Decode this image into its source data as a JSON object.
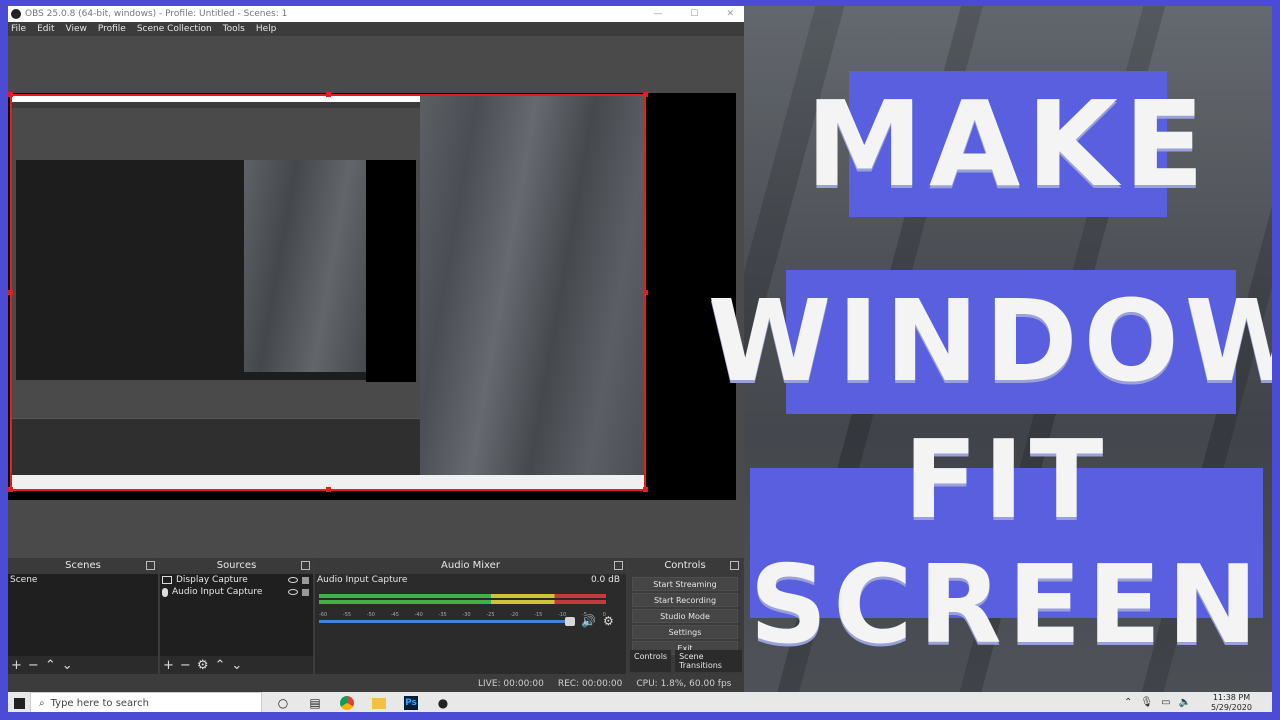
{
  "obs": {
    "title": "OBS 25.0.8 (64-bit, windows) - Profile: Untitled - Scenes: 1",
    "menu": [
      "File",
      "Edit",
      "View",
      "Profile",
      "Scene Collection",
      "Tools",
      "Help"
    ],
    "docks": {
      "scenes": {
        "title": "Scenes",
        "items": [
          "Scene"
        ]
      },
      "sources": {
        "title": "Sources",
        "items": [
          {
            "label": "Display Capture",
            "icon": "monitor-icon"
          },
          {
            "label": "Audio Input Capture",
            "icon": "microphone-icon"
          }
        ]
      },
      "mixer": {
        "title": "Audio Mixer",
        "channel": "Audio Input Capture",
        "db": "0.0 dB",
        "scale": [
          "-60",
          "-55",
          "-50",
          "-45",
          "-40",
          "-35",
          "-30",
          "-25",
          "-20",
          "-15",
          "-10",
          "-5",
          "0"
        ]
      },
      "controls": {
        "title": "Controls",
        "buttons": [
          "Start Streaming",
          "Start Recording",
          "Studio Mode",
          "Settings",
          "Exit"
        ],
        "tabs": [
          "Controls",
          "Scene Transitions"
        ]
      }
    },
    "status": {
      "live": "LIVE: 00:00:00",
      "rec": "REC: 00:00:00",
      "cpu": "CPU: 1.8%, 60.00 fps"
    }
  },
  "banner": {
    "line1": "MAKE",
    "line2": "WINDOW",
    "line3": "FIT SCREEN"
  },
  "taskbar": {
    "search_placeholder": "Type here to search",
    "time": "11:38 PM",
    "date": "5/29/2020",
    "apps": [
      "cortana-icon",
      "task-view-icon",
      "chrome-icon",
      "file-explorer-icon",
      "photoshop-icon",
      "obs-icon"
    ],
    "ps_label": "Ps"
  },
  "colors": {
    "accent": "#5a5fe0",
    "frame": "#4b4bd6",
    "selection": "#e01f1f"
  }
}
